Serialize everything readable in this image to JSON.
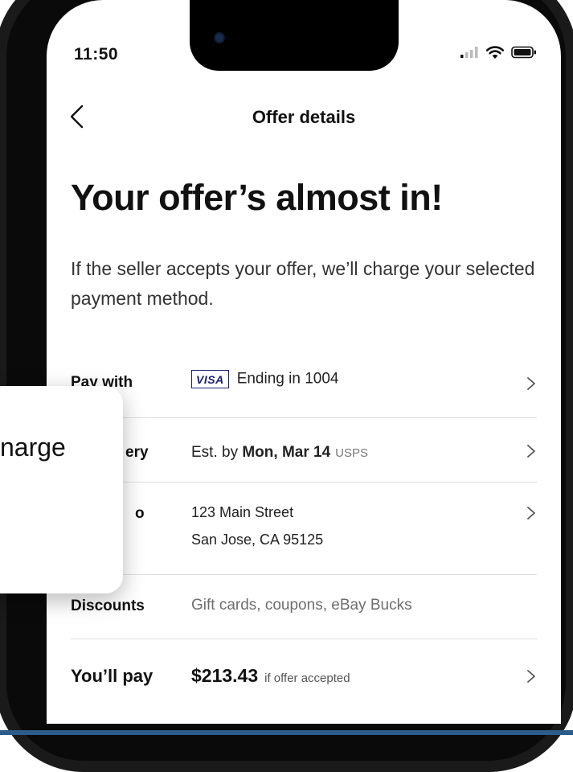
{
  "status": {
    "time": "11:50"
  },
  "nav": {
    "title": "Offer details"
  },
  "headline": "Your offer’s almost in!",
  "subtext": "If the seller accepts your offer, we’ll charge your selected payment method.",
  "rows": {
    "pay": {
      "label": "Pay with",
      "card_brand": "VISA",
      "value": "Ending in 1004"
    },
    "delivery": {
      "label": "ery",
      "prefix": "Est. by ",
      "date": "Mon, Mar 14",
      "carrier": "USPS"
    },
    "ship": {
      "label": "o",
      "line1": "123 Main Street",
      "line2": "San Jose, CA 95125"
    },
    "discounts": {
      "label": "Discounts",
      "value": "Gift cards, coupons, eBay Bucks"
    },
    "total": {
      "label": "You’ll pay",
      "amount": "$213.43",
      "note": "if offer accepted"
    }
  },
  "toast": {
    "text": "narge"
  },
  "icons": [
    "chevron-left-icon",
    "chevron-right-icon",
    "signal-icon",
    "wifi-icon",
    "battery-icon"
  ]
}
